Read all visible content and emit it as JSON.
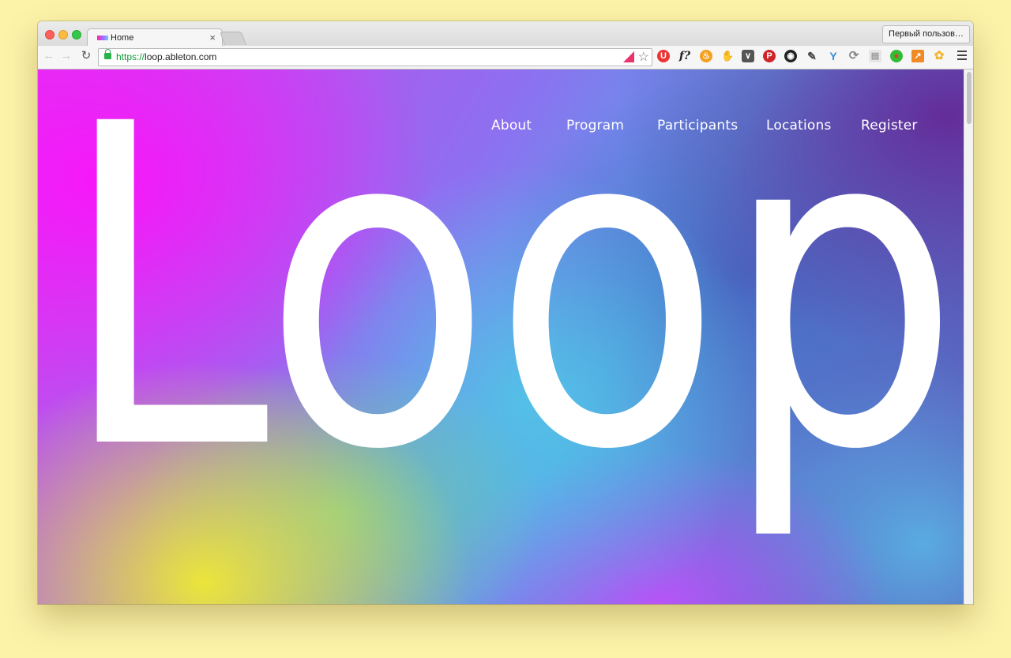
{
  "browser": {
    "tab_title": "Home",
    "tab_close": "×",
    "profile_button": "Первый пользов…",
    "url_scheme": "https://",
    "url_rest": "loop.ableton.com"
  },
  "page": {
    "logo": "Loop",
    "nav": [
      "About",
      "Program",
      "Participants",
      "Locations",
      "Register"
    ]
  },
  "extensions": [
    "ublock-icon",
    "fontface-icon",
    "fire-icon",
    "evernote-icon",
    "pocket-icon",
    "pinterest-icon",
    "camera-icon",
    "eyedropper-icon",
    "diamond-icon",
    "refresh-circle-icon",
    "reader-icon",
    "flag-icon",
    "chart-icon",
    "flower-icon"
  ]
}
